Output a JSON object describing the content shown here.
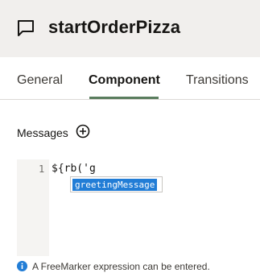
{
  "header": {
    "title": "startOrderPizza",
    "icon": "flag-icon"
  },
  "tabs": [
    {
      "label": "General",
      "active": false
    },
    {
      "label": "Component",
      "active": true
    },
    {
      "label": "Transitions",
      "active": false
    }
  ],
  "colors": {
    "header_bg": "#f1efed",
    "active_tab_underline": "#5a7d5e",
    "autocomplete_selected": "#227dd6",
    "info_icon": "#227dd6"
  },
  "messages": {
    "label": "Messages",
    "add_icon": "plus-circle-icon"
  },
  "editor": {
    "line_number": "1",
    "code": "${rb('g",
    "autocomplete": [
      "greetingMessage"
    ]
  },
  "hint": {
    "icon": "info-icon",
    "text": "A FreeMarker expression can be entered."
  }
}
